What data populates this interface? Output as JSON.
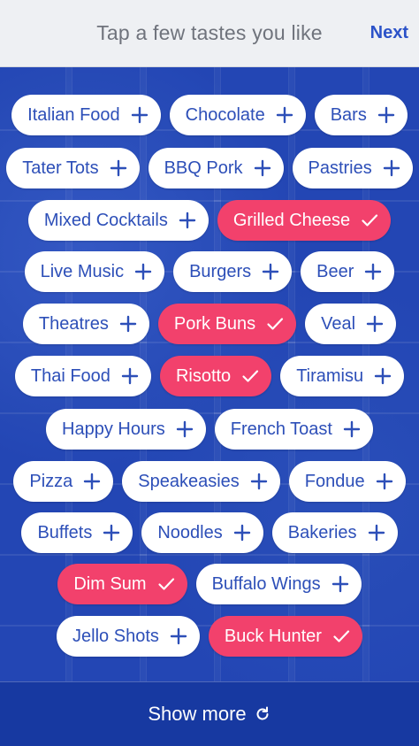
{
  "header": {
    "title": "Tap a few tastes you like",
    "next_label": "Next"
  },
  "rows": [
    [
      {
        "label": "Italian Food",
        "selected": false
      },
      {
        "label": "Chocolate",
        "selected": false
      },
      {
        "label": "Bars",
        "selected": false
      }
    ],
    [
      {
        "label": "Tater Tots",
        "selected": false
      },
      {
        "label": "BBQ Pork",
        "selected": false
      },
      {
        "label": "Pastries",
        "selected": false
      }
    ],
    [
      {
        "label": "Mixed Cocktails",
        "selected": false
      },
      {
        "label": "Grilled Cheese",
        "selected": true
      }
    ],
    [
      {
        "label": "Live Music",
        "selected": false
      },
      {
        "label": "Burgers",
        "selected": false
      },
      {
        "label": "Beer",
        "selected": false
      }
    ],
    [
      {
        "label": "Theatres",
        "selected": false
      },
      {
        "label": "Pork Buns",
        "selected": true
      },
      {
        "label": "Veal",
        "selected": false
      }
    ],
    [
      {
        "label": "Thai Food",
        "selected": false
      },
      {
        "label": "Risotto",
        "selected": true
      },
      {
        "label": "Tiramisu",
        "selected": false
      }
    ],
    [
      {
        "label": "Happy Hours",
        "selected": false
      },
      {
        "label": "French Toast",
        "selected": false
      }
    ],
    [
      {
        "label": "Pizza",
        "selected": false
      },
      {
        "label": "Speakeasies",
        "selected": false
      },
      {
        "label": "Fondue",
        "selected": false
      }
    ],
    [
      {
        "label": "Buffets",
        "selected": false
      },
      {
        "label": "Noodles",
        "selected": false
      },
      {
        "label": "Bakeries",
        "selected": false
      }
    ],
    [
      {
        "label": "Dim Sum",
        "selected": true
      },
      {
        "label": "Buffalo Wings",
        "selected": false
      }
    ],
    [
      {
        "label": "Jello Shots",
        "selected": false
      },
      {
        "label": "Buck Hunter",
        "selected": true
      }
    ]
  ],
  "footer": {
    "label": "Show more",
    "icon": "refresh-icon"
  },
  "colors": {
    "accent": "#2b52c8",
    "selected": "#f2416c",
    "background": "#1b3fb1"
  }
}
